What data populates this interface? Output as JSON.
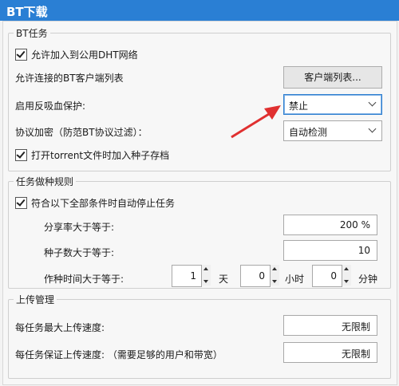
{
  "window": {
    "title": "BT下载"
  },
  "bt_task": {
    "legend": "BT任务",
    "dht_label": "允许加入到公用DHT网络",
    "allowed_clients_label": "允许连接的BT客户端列表",
    "client_list_button": "客户端列表...",
    "anti_leech_label": "启用反吸血保护:",
    "anti_leech_value": "禁止",
    "encryption_label": "协议加密（防范BT协议过滤）：",
    "encryption_value": "自动检测",
    "open_torrent_label": "打开torrent文件时加入种子存档"
  },
  "seeding": {
    "legend": "任务做种规则",
    "auto_stop_label": "符合以下全部条件时自动停止任务",
    "share_ratio_label": "分享率大于等于:",
    "share_ratio_value": "200 %",
    "seed_count_label": "种子数大于等于:",
    "seed_count_value": "10",
    "seed_time_label": "作种时间大于等于:",
    "days_value": "1",
    "days_unit": "天",
    "hours_value": "0",
    "hours_unit": "小时",
    "minutes_value": "0",
    "minutes_unit": "分钟"
  },
  "upload": {
    "legend": "上传管理",
    "max_speed_label": "每任务最大上传速度:",
    "max_speed_value": "无限制",
    "guaranteed_speed_label": "每任务保证上传速度: （需要足够的用户和带宽）",
    "guaranteed_speed_value": "无限制"
  },
  "annotation": {
    "arrow_color": "#e03030"
  }
}
